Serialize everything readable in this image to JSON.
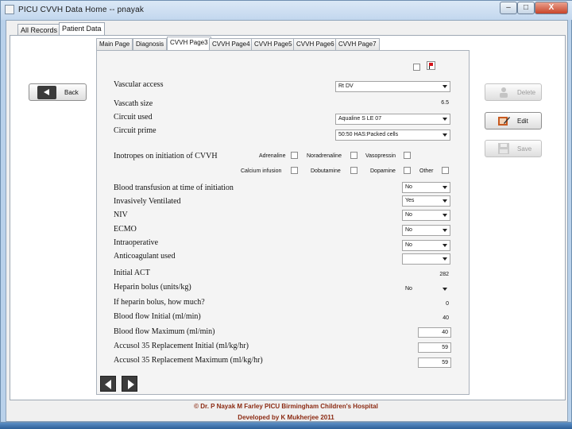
{
  "window": {
    "title": "PICU CVVH Data Home -- pnayak",
    "min_label": "–",
    "max_label": "□",
    "close_label": "X"
  },
  "outer_tabs": [
    "All Records",
    "Patient Data"
  ],
  "inner_tabs": [
    "Main Page",
    "Diagnosis",
    "CVVH Page3",
    "CVVH Page4",
    "CVVH Page5",
    "CVVH Page6",
    "CVVH Page7"
  ],
  "buttons": {
    "back": "Back",
    "delete": "Delete",
    "edit": "Edit",
    "save": "Save"
  },
  "form": {
    "vascular_access_label": "Vascular access",
    "vascular_access_value": "Rt DV",
    "vascath_size_label": "Vascath size",
    "vascath_size_value": "6.5",
    "circuit_used_label": "Circuit used",
    "circuit_used_value": "Aqualine S LE 07",
    "circuit_prime_label": "Circuit prime",
    "circuit_prime_value": "50:50 HAS:Packed cells",
    "inotropes_label": "Inotropes on initiation of CVVH",
    "inotropes": {
      "adrenaline": "Adrenaline",
      "noradrenaline": "Noradrenaline",
      "vasopressin": "Vasopressin",
      "calcium_infusion": "Calcium infusion",
      "dobutamine": "Dobutamine",
      "dopamine": "Dopamine",
      "other": "Other"
    },
    "blood_transfusion_label": "Blood transfusion at time of initiation",
    "blood_transfusion_value": "No",
    "invasively_ventilated_label": "Invasively Ventilated",
    "invasively_ventilated_value": "Yes",
    "niv_label": "NIV",
    "niv_value": "No",
    "ecmo_label": "ECMO",
    "ecmo_value": "No",
    "intraoperative_label": "Intraoperative",
    "intraoperative_value": "No",
    "anticoagulant_label": "Anticoagulant used",
    "anticoagulant_value": "",
    "initial_act_label": "Initial ACT",
    "initial_act_value": "282",
    "heparin_bolus_label": "Heparin bolus (units/kg)",
    "heparin_bolus_value": "No",
    "heparin_how_much_label": "If heparin bolus, how much?",
    "heparin_how_much_value": "0",
    "blood_flow_initial_label": "Blood flow Initial (ml/min)",
    "blood_flow_initial_value": "40",
    "blood_flow_max_label": "Blood flow Maximum (ml/min)",
    "blood_flow_max_value": "40",
    "accusol_initial_label": "Accusol 35 Replacement Initial  (ml/kg/hr)",
    "accusol_initial_value": "59",
    "accusol_max_label": "Accusol 35 Replacement Maximum  (ml/kg/hr)",
    "accusol_max_value": "59"
  },
  "footer": {
    "line1": "© Dr. P Nayak  M Farley  PICU Birmingham Children's Hospital",
    "line2": "Developed by K Mukherjee 2011"
  },
  "colors": {
    "footer_text": "#8b2a12",
    "flag": "#d4141a"
  }
}
